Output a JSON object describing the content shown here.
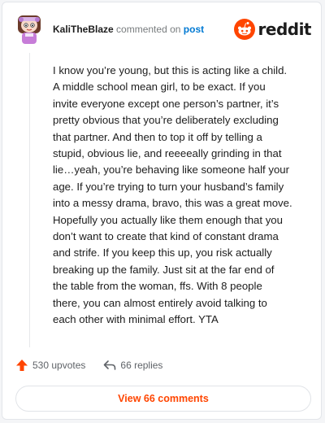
{
  "header": {
    "username": "KaliTheBlaze",
    "action_text": "commented on",
    "post_link": "post",
    "brand": "reddit"
  },
  "comment": {
    "lines": [
      "I know you’re young, but this is acting like a child.",
      "A middle school mean girl, to be exact. If you",
      "invite everyone except one person’s partner, it’s",
      "pretty obvious that you’re deliberately excluding",
      "that partner. And then to top it off by telling a",
      "stupid, obvious lie, and reeeeally grinding in that",
      "lie…yeah, you’re behaving like someone half your",
      "age. If you’re trying to turn your husband’s family",
      "into a messy drama, bravo, this was a great move.",
      "Hopefully you actually like them enough that you",
      "don’t want to create that kind of constant drama",
      "and strife. If you keep this up, you risk actually",
      "breaking up the family. Just sit at the far end of",
      "the table from the woman, ffs. With 8 people",
      "there, you can almost entirely avoid talking to",
      "each other with minimal effort. YTA"
    ]
  },
  "footer": {
    "upvotes": "530 upvotes",
    "replies": "66 replies",
    "view_button": "View 66 comments"
  },
  "colors": {
    "accent": "#ff4500",
    "link": "#0079d3",
    "muted": "#787c7e"
  },
  "icons": {
    "avatar": "avatar-icon",
    "brand": "reddit-snoo-icon",
    "upvote": "upvote-arrow-icon",
    "reply": "reply-arrow-icon"
  }
}
